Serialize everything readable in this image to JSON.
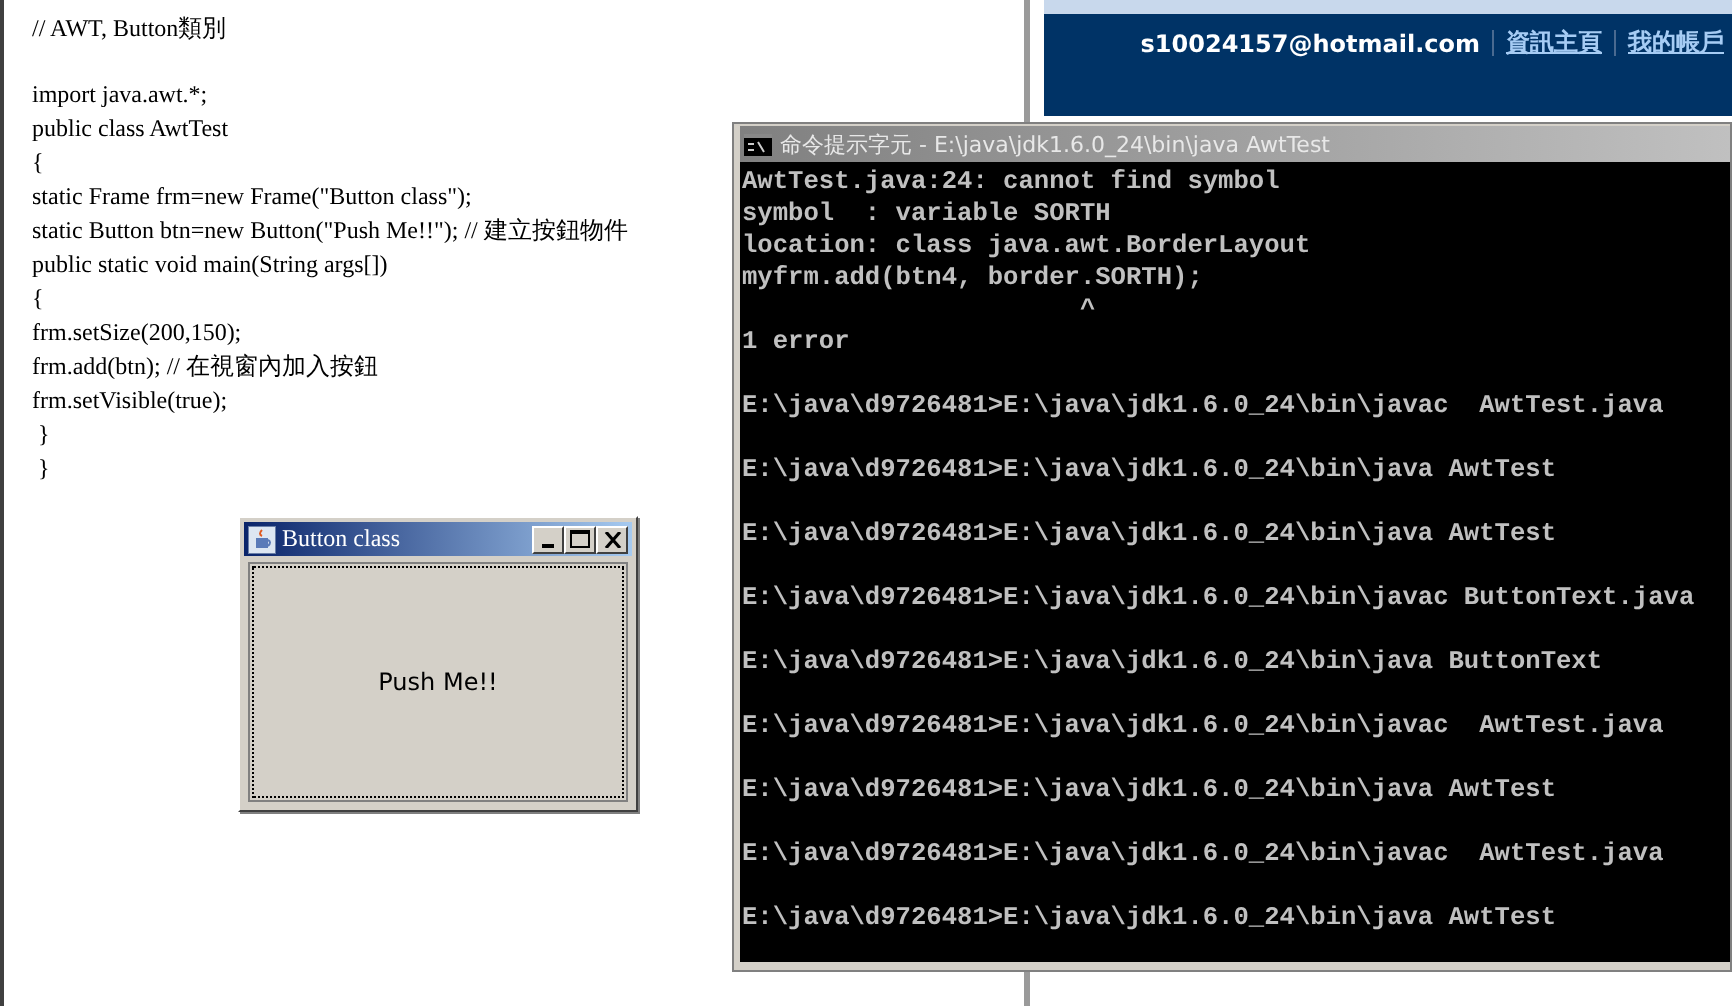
{
  "document": {
    "paragraphs": [
      [
        "// AWT, Button類別"
      ],
      [
        "import java.awt.*;",
        "public class AwtTest",
        "{",
        "static Frame frm=new Frame(\"Button class\");",
        "static Button btn=new Button(\"Push Me!!\"); // 建立按鈕物件",
        "public static void main(String args[])",
        "{",
        "frm.setSize(200,150);",
        "frm.add(btn); // 在視窗內加入按鈕",
        "frm.setVisible(true);",
        " }",
        " }"
      ]
    ]
  },
  "web_header": {
    "email": "s10024157@hotmail.com",
    "links": [
      "資訊主頁",
      "我的帳戶"
    ]
  },
  "console": {
    "title": "命令提示字元 - E:\\java\\jdk1.6.0_24\\bin\\java AwtTest",
    "blocks": [
      [
        "AwtTest.java:24: cannot find symbol",
        "symbol  : variable SORTH",
        "location: class java.awt.BorderLayout",
        "myfrm.add(btn4, border.SORTH);",
        "                      ^",
        "1 error"
      ],
      [
        "E:\\java\\d9726481>E:\\java\\jdk1.6.0_24\\bin\\javac  AwtTest.java"
      ],
      [
        "E:\\java\\d9726481>E:\\java\\jdk1.6.0_24\\bin\\java AwtTest"
      ],
      [
        "E:\\java\\d9726481>E:\\java\\jdk1.6.0_24\\bin\\java AwtTest"
      ],
      [
        "E:\\java\\d9726481>E:\\java\\jdk1.6.0_24\\bin\\javac ButtonText.java"
      ],
      [
        "E:\\java\\d9726481>E:\\java\\jdk1.6.0_24\\bin\\java ButtonText"
      ],
      [
        "E:\\java\\d9726481>E:\\java\\jdk1.6.0_24\\bin\\javac  AwtTest.java"
      ],
      [
        "E:\\java\\d9726481>E:\\java\\jdk1.6.0_24\\bin\\java AwtTest"
      ],
      [
        "E:\\java\\d9726481>E:\\java\\jdk1.6.0_24\\bin\\javac  AwtTest.java"
      ],
      [
        "E:\\java\\d9726481>E:\\java\\jdk1.6.0_24\\bin\\java AwtTest"
      ]
    ]
  },
  "java_frame": {
    "title": "Button class",
    "button_label": "Push Me!!"
  }
}
